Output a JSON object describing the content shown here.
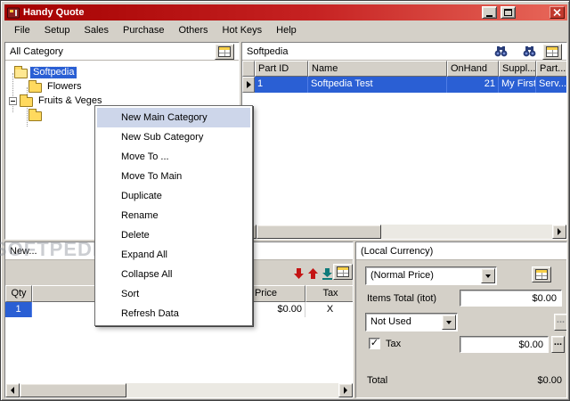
{
  "titlebar": {
    "title": "Handy Quote"
  },
  "menubar": {
    "items": [
      "File",
      "Setup",
      "Sales",
      "Purchase",
      "Others",
      "Hot Keys",
      "Help"
    ]
  },
  "category_panel": {
    "header": "All Category",
    "tree": [
      {
        "label": "Softpedia"
      },
      {
        "label": "Flowers"
      },
      {
        "label": "Fruits & Veges"
      },
      {
        "label": ""
      }
    ]
  },
  "parts_panel": {
    "header": "Softpedia",
    "columns": [
      "Part ID",
      "Name",
      "OnHand",
      "Suppl...",
      "Part..."
    ],
    "row": [
      "1",
      "Softpedia Test",
      "21",
      "My First",
      "Serv..."
    ]
  },
  "context_menu": {
    "items": [
      "New Main Category",
      "New Sub Category",
      "Move To ...",
      "Move To Main",
      "Duplicate",
      "Rename",
      "Delete",
      "Expand All",
      "Collapse All",
      "Sort",
      "Refresh Data"
    ]
  },
  "quote_panel": {
    "header": "New...",
    "watermark": "SOFTPEDIA",
    "columns": {
      "qty": "Qty",
      "price": "Price",
      "tax": "Tax"
    },
    "row": {
      "qty": "1",
      "price": "$0.00",
      "tax": "X"
    }
  },
  "totals_panel": {
    "header": "(Local Currency)",
    "price_combo": "(Normal Price)",
    "items_total_label": "Items Total (itot)",
    "items_total_value": "$0.00",
    "discount_combo": "Not Used",
    "discount_more_label": "...",
    "tax_label": "Tax",
    "tax_check_glyph": "✓",
    "tax_value": "$0.00",
    "tax_more_label": "...",
    "total_label": "Total",
    "total_value": "$0.00"
  },
  "colors": {
    "selection_blue": "#2a5fd4",
    "titlebar_red": "#c62222"
  }
}
